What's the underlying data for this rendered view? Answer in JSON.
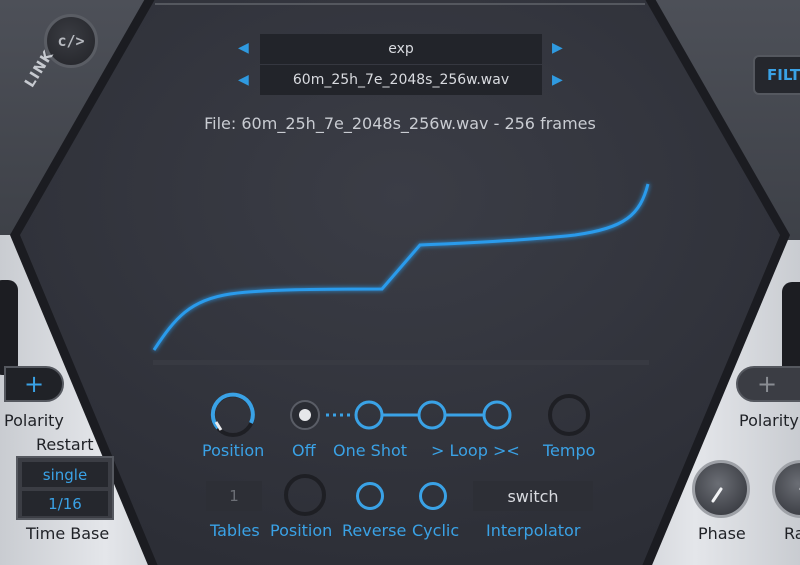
{
  "left_panel": {
    "link_icon": "code-link-icon",
    "link_glyph": "c/>",
    "link_label": "LINK",
    "polarity_symbol": "+",
    "polarity_label": "Polarity",
    "restart_label": "Restart",
    "time_base": {
      "mode": "single",
      "division": "1/16",
      "label": "Time Base"
    }
  },
  "right_panel": {
    "filter_tab_label": "FILT",
    "polarity_symbol": "+",
    "polarity_label": "Polarity",
    "phase_label": "Phase",
    "rate_label": "Ra"
  },
  "wavetable": {
    "category": "exp",
    "file": "60m_25h_7e_2048s_256w.wav",
    "file_info": "File: 60m_25h_7e_2048s_256w.wav - 256 frames"
  },
  "controls_row1": {
    "position_label": "Position",
    "off_label": "Off",
    "one_shot_label": "One Shot",
    "loop_label": "> Loop ><",
    "tempo_label": "Tempo"
  },
  "controls_row2": {
    "tables_value": "1",
    "tables_label": "Tables",
    "position_label": "Position",
    "reverse_label": "Reverse",
    "cyclic_label": "Cyclic",
    "interpolator_value": "switch",
    "interpolator_label": "Interpolator"
  },
  "colors": {
    "accent": "#3aa2e6",
    "hex_face": "#34363f",
    "wave": "#2a9bec"
  }
}
